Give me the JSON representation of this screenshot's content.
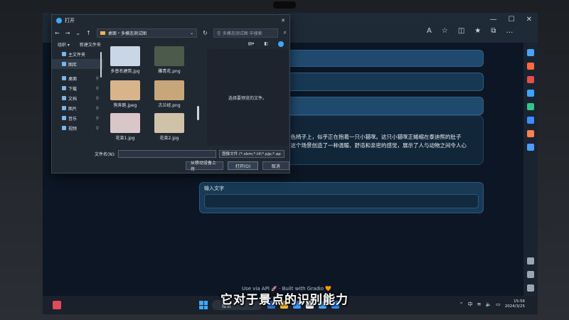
{
  "browser": {
    "sidebar_colors": [
      "#4aa3ff",
      "#ff6a3d",
      "#e64d4d",
      "#3da3ff",
      "#35c58a",
      "#3f8cff",
      "#ff7f50",
      "#4b9cff",
      "#9aa6b2",
      "#9aa6b2",
      "#9aa6b2"
    ]
  },
  "dialog": {
    "title": "打开",
    "close": "✕",
    "breadcrumb": [
      "桌面",
      "多模态测试图"
    ],
    "search_placeholder": "在 多模态测试图 中搜索",
    "toolbar": {
      "organize": "组织 ▾",
      "new_folder": "新建文件夹"
    },
    "nav": [
      {
        "label": "主文件夹",
        "icon": "home-icon",
        "selected": false,
        "pinned": false
      },
      {
        "label": "图库",
        "icon": "gallery-icon",
        "selected": true,
        "pinned": false
      },
      {
        "label": "桌面",
        "icon": "desktop-icon",
        "selected": false,
        "pinned": true
      },
      {
        "label": "下载",
        "icon": "download-icon",
        "selected": false,
        "pinned": true
      },
      {
        "label": "文档",
        "icon": "document-icon",
        "selected": false,
        "pinned": true
      },
      {
        "label": "图片",
        "icon": "picture-icon",
        "selected": false,
        "pinned": true
      },
      {
        "label": "音乐",
        "icon": "music-icon",
        "selected": false,
        "pinned": true
      },
      {
        "label": "视频",
        "icon": "video-icon",
        "selected": false,
        "pinned": true
      }
    ],
    "files": [
      {
        "name": "多普名建筑.jpg",
        "color": "#c9d6e6"
      },
      {
        "name": "雕青花.png",
        "color": "#4b5a4a"
      },
      {
        "name": "狗奔跑.jpeg",
        "color": "#d9b48a"
      },
      {
        "name": "古兰经.png",
        "color": "#c9a57a"
      },
      {
        "name": "花束1.jpg",
        "color": "#d8c6c8"
      },
      {
        "name": "花束2.jpg",
        "color": "#cfc2a8"
      }
    ],
    "preview_text": "选择要预览的文件。",
    "filename_label": "文件名(N):",
    "filetype": "图像文件 (*.xbm;*.tif;*.pjp;*.ap",
    "upload_button": "从移动设备上传",
    "open_button": "打开(O)",
    "cancel_button": "取消"
  },
  "page": {
    "chat_text_line1": "绿色椅子上，似乎正在抱着一只小猫咪。这只小猫咪正蜷缩在泰迪熊的肚子",
    "chat_text_line2": "，这个场景创造了一种温暖、舒适和亲密的感觉，展示了人与动物之间令人心",
    "input_label": "输入文字",
    "footer": "Use via API 🚀 · Built with Gradio 🧡"
  },
  "taskbar": {
    "search": "搜索",
    "icon_colors": [
      "#2f6fd6",
      "#f5b52e",
      "#3aa0ff",
      "#e8eef5",
      "#4ea8ff",
      "#2d8cff"
    ],
    "ime": "中",
    "time": "15:56",
    "date": "2024/3/25"
  },
  "subtitle": "它对于景点的识别能力"
}
